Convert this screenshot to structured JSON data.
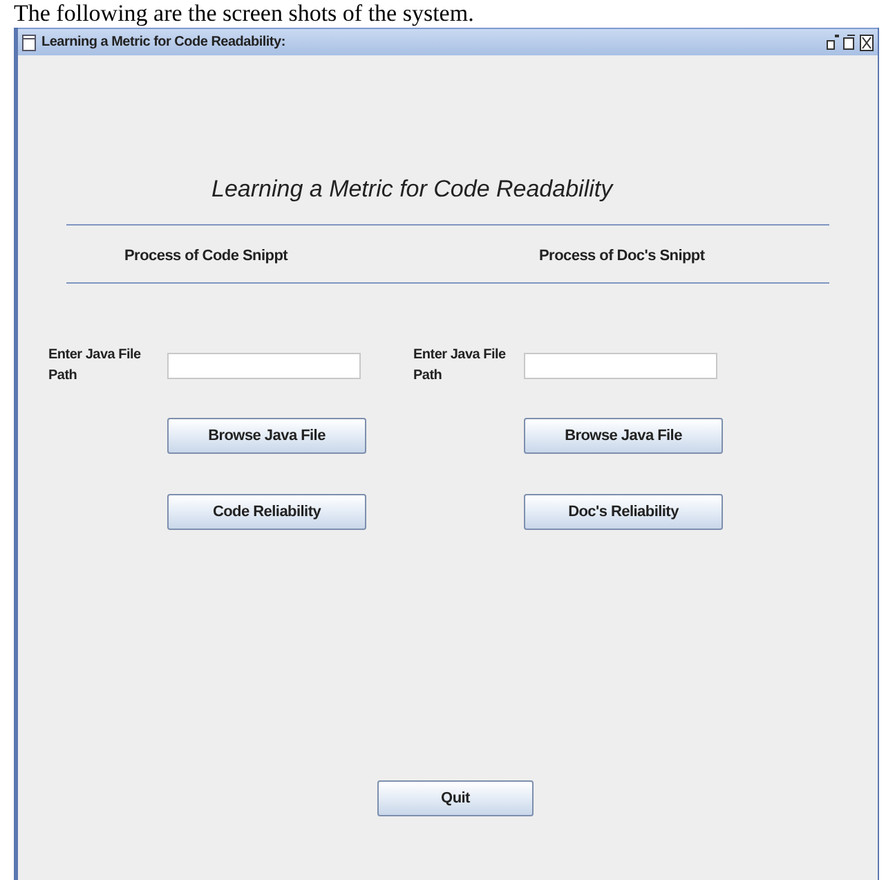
{
  "caption": "The following are the screen shots of the system.",
  "window": {
    "title": "Learning a Metric for Code Readability:"
  },
  "heading": "Learning a Metric for Code Readability",
  "sections": [
    {
      "title": "Process of Code Snippt",
      "field_label": "Enter Java File Path",
      "buttons": [
        "Browse Java File",
        "Code Reliability"
      ]
    },
    {
      "title": "Process of Doc's Snippt",
      "field_label": "Enter Java File Path",
      "buttons": [
        "Browse Java File",
        "Doc's Reliability"
      ]
    }
  ],
  "quit_button": "Quit"
}
